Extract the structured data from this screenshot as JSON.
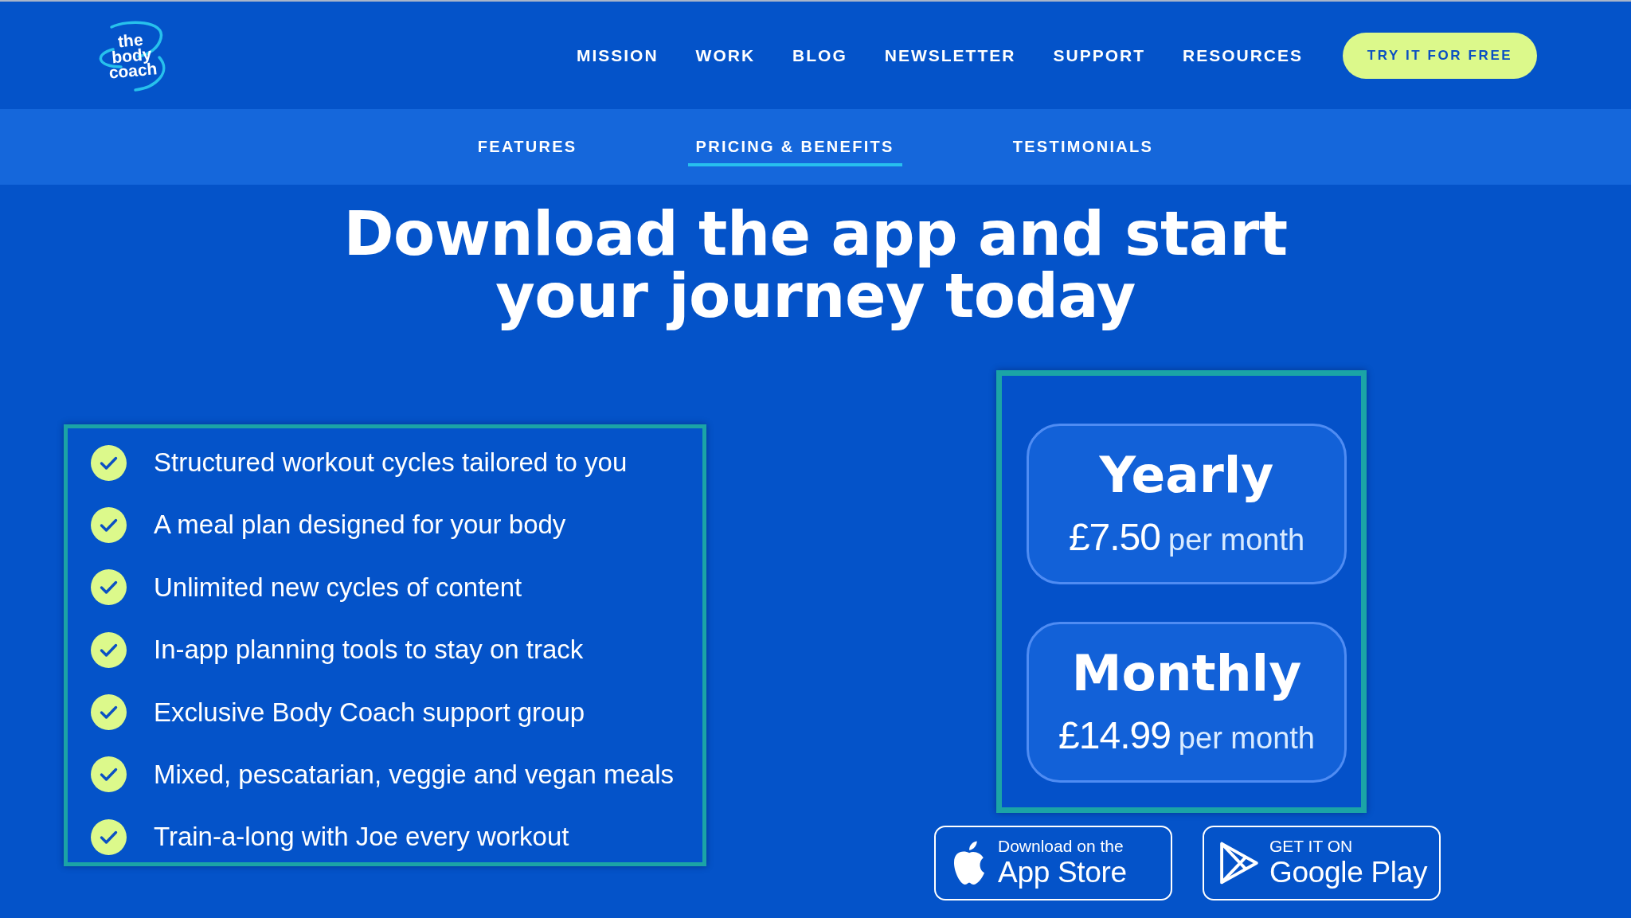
{
  "header": {
    "logo": {
      "text": "the body coach"
    },
    "nav_links": [
      "MISSION",
      "WORK",
      "BLOG",
      "NEWSLETTER",
      "SUPPORT",
      "RESOURCES"
    ],
    "cta_button": "TRY IT FOR FREE"
  },
  "section_tabs": [
    {
      "label": "FEATURES",
      "selected": false
    },
    {
      "label": "PRICING & BENEFITS",
      "selected": true
    },
    {
      "label": "TESTIMONIALS",
      "selected": false
    }
  ],
  "heading": "Download the app and start your journey today",
  "features": [
    "Structured workout cycles tailored to you",
    "A meal plan designed for your body",
    "Unlimited new cycles of content",
    "In-app planning tools to stay on track",
    "Exclusive Body Coach support group",
    "Mixed, pescatarian, veggie and vegan meals",
    "Train-a-long with Joe every workout"
  ],
  "plans": [
    {
      "name": "Yearly",
      "price": "£7.50",
      "period": "per month"
    },
    {
      "name": "Monthly",
      "price": "£14.99",
      "period": "per month"
    }
  ],
  "store_badges": [
    {
      "kind": "apple",
      "caption": "Download on the",
      "title": "App Store"
    },
    {
      "kind": "google",
      "caption": "GET IT ON",
      "title": "Google Play"
    }
  ]
}
